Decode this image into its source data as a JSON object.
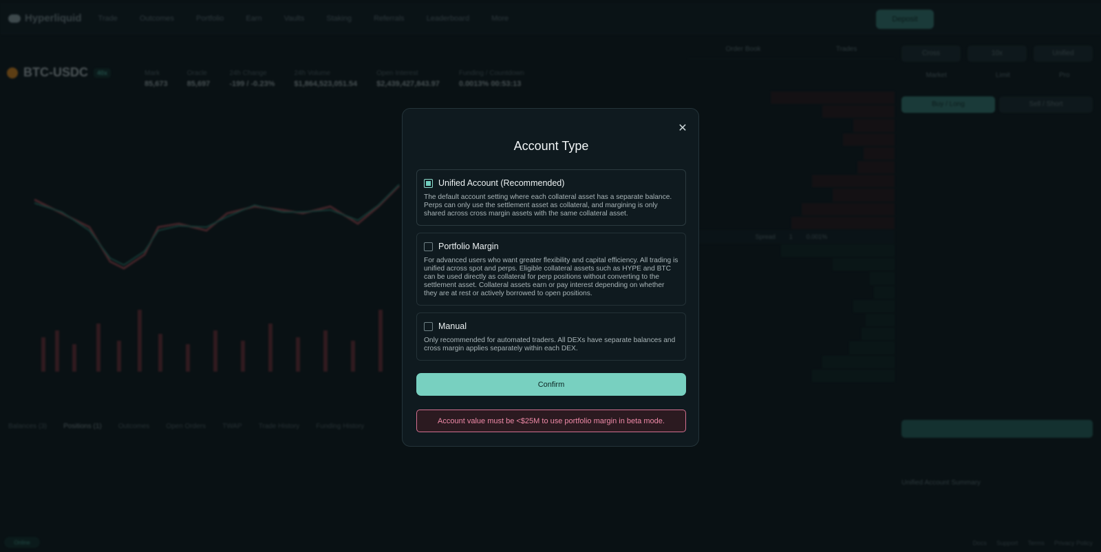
{
  "app": {
    "logo_text": "Hyperliquid",
    "nav": [
      "Trade",
      "Outcomes",
      "Portfolio",
      "Earn",
      "Vaults",
      "Staking",
      "Referrals",
      "Leaderboard",
      "More"
    ],
    "deposit_label": "Deposit"
  },
  "market": {
    "pair": "BTC-USDC",
    "leverage_badge": "40x",
    "stats": [
      {
        "label": "Mark",
        "value": "85,673"
      },
      {
        "label": "Oracle",
        "value": "85,697"
      },
      {
        "label": "24h Change",
        "value": "-199 / -0.23%"
      },
      {
        "label": "24h Volume",
        "value": "$1,864,523,051.54"
      },
      {
        "label": "Open Interest",
        "value": "$2,439,427,843.97"
      },
      {
        "label": "Funding / Countdown",
        "value": "0.0013%  00:53:13"
      }
    ]
  },
  "orderbook": {
    "tabs": [
      "Order Book",
      "Trades"
    ],
    "spread_label": "Spread",
    "spread_value": "1",
    "spread_pct": "0.001%"
  },
  "right_panel": {
    "mode_buttons": [
      "Cross",
      "10x",
      "Unified"
    ],
    "order_types": [
      "Market",
      "Limit",
      "Pro"
    ],
    "sides": [
      "Buy / Long",
      "Sell / Short"
    ],
    "summary_title": "Unified Account Summary"
  },
  "bottom": {
    "tabs": [
      "Balances (3)",
      "Positions (1)",
      "Outcomes",
      "Open Orders",
      "TWAP",
      "Trade History",
      "Funding History"
    ]
  },
  "modal": {
    "title": "Account Type",
    "options": [
      {
        "title": "Unified Account (Recommended)",
        "checked": true,
        "description": "The default account setting where each collateral asset has a separate balance. Perps can only use the settlement asset as collateral, and margining is only shared across cross margin assets with the same collateral asset."
      },
      {
        "title": "Portfolio Margin",
        "checked": false,
        "description": "For advanced users who want greater flexibility and capital efficiency. All trading is unified across spot and perps. Eligible collateral assets such as HYPE and BTC can be used directly as collateral for perp positions without converting to the settlement asset. Collateral assets earn or pay interest depending on whether they are at rest or actively borrowed to open positions."
      },
      {
        "title": "Manual",
        "checked": false,
        "description": "Only recommended for automated traders. All DEXs have separate balances and cross margin applies separately within each DEX."
      }
    ],
    "confirm_label": "Confirm",
    "warning": "Account value must be <$25M to use portfolio margin in beta mode."
  },
  "footer": {
    "links": [
      "Docs",
      "Support",
      "Terms",
      "Privacy Policy"
    ],
    "status": "Online"
  },
  "colors": {
    "accent": "#78d0c0",
    "warning_border": "#d57191",
    "background": "#0b1417"
  }
}
